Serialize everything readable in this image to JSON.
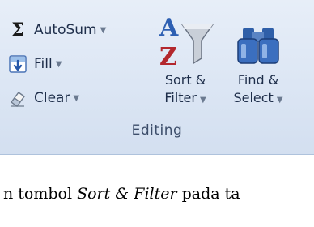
{
  "editing_group": {
    "label": "Editing",
    "autosum": {
      "label": "AutoSum",
      "caret": "▼",
      "icon": "sigma-icon"
    },
    "fill": {
      "label": "Fill",
      "caret": "▼",
      "icon": "fill-down-icon"
    },
    "clear": {
      "label": "Clear",
      "caret": "▼",
      "icon": "eraser-icon"
    },
    "sort_filter": {
      "line1": "Sort &",
      "line2": "Filter",
      "caret": "▼",
      "icon": "sort-filter-icon"
    },
    "find_select": {
      "line1": "Find &",
      "line2": "Select",
      "caret": "▼",
      "icon": "binoculars-icon"
    }
  },
  "caption": {
    "prefix": "n tombol",
    "emphasis": "Sort & Filter",
    "suffix": "pada ta"
  },
  "colors": {
    "ribbon_bg": "#dce6f4",
    "label_text": "#1e2e4a"
  }
}
